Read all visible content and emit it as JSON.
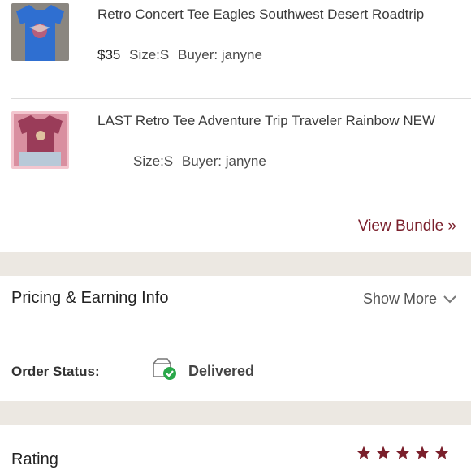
{
  "items": [
    {
      "title": "Retro Concert Tee Eagles Southwest Desert Roadtrip",
      "price": "$35",
      "size": "Size:S",
      "buyer": "Buyer: janyne"
    },
    {
      "title": "LAST Retro Tee Adventure Trip Traveler Rainbow NEW",
      "size": "Size:S",
      "buyer": "Buyer: janyne"
    }
  ],
  "bundle": {
    "view_label": "View Bundle »"
  },
  "pricing": {
    "title": "Pricing & Earning Info",
    "show_more": "Show More"
  },
  "order": {
    "label": "Order Status:",
    "status": "Delivered"
  },
  "rating": {
    "label": "Rating",
    "stars": 5,
    "star_color": "#7a1f2b"
  },
  "colors": {
    "accent": "#7a1f2b",
    "band": "#ece8e2",
    "delivered_green": "#2aa84a"
  },
  "icons": {
    "show_more": "chevron-down-icon",
    "delivery": "box-check-icon",
    "star": "star-icon"
  }
}
